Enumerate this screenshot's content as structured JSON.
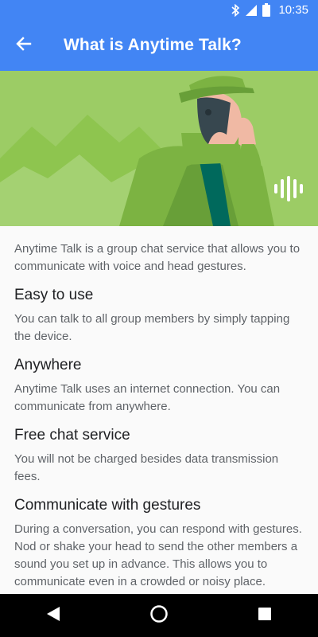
{
  "status_bar": {
    "time": "10:35",
    "icons": [
      "bluetooth-icon",
      "signal-icon",
      "battery-icon"
    ]
  },
  "app_bar": {
    "title": "What is Anytime Talk?",
    "back_icon": "arrow-back-icon"
  },
  "content": {
    "intro": "Anytime Talk is a group chat service that allows you to communicate with voice and head gestures.",
    "sections": [
      {
        "title": "Easy to use",
        "body": "You can talk to all group members by simply tapping the device."
      },
      {
        "title": "Anywhere",
        "body": "Anytime Talk uses an internet connection. You can communicate from anywhere."
      },
      {
        "title": "Free chat service",
        "body": "You will not be charged besides data transmission fees."
      },
      {
        "title": "Communicate with gestures",
        "body": "During a conversation, you can respond with gestures. Nod or shake your head to send the other members a sound you set up in advance. This allows you to communicate even in a crowded or noisy place."
      }
    ]
  },
  "nav_bar": {
    "buttons": [
      "back-triangle-icon",
      "home-circle-icon",
      "recents-square-icon"
    ]
  },
  "colors": {
    "primary": "#4285f4",
    "hero_bg": "#9ccc65",
    "title_text": "#202124",
    "body_text": "#5f6368"
  }
}
